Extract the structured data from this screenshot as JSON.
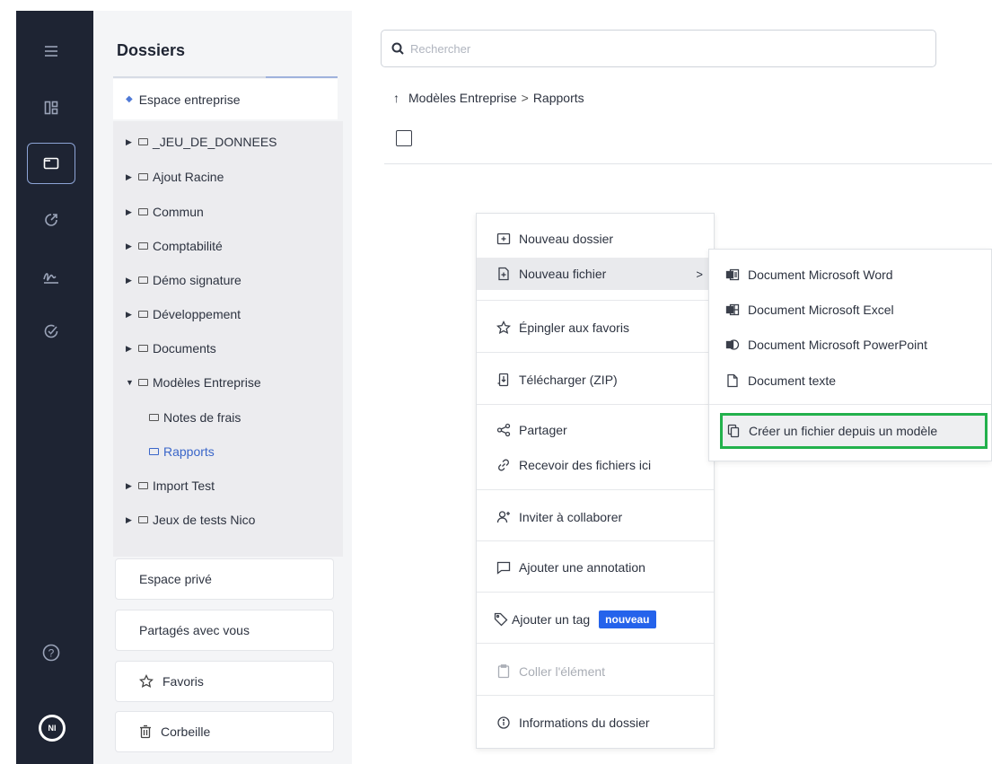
{
  "rail": {
    "icons": [
      "menu-icon",
      "dashboard-icon",
      "folder-icon",
      "activity-icon",
      "signature-icon",
      "check-circle-icon",
      "help-icon"
    ],
    "avatar_initials": "NI",
    "help_glyph": "?"
  },
  "sidebar": {
    "title": "Dossiers",
    "workspace": "Espace entreprise",
    "tree": [
      {
        "label": "_JEU_DE_DONNEES",
        "expanded": false,
        "level": 0
      },
      {
        "label": "Ajout Racine",
        "expanded": false,
        "level": 0
      },
      {
        "label": "Commun",
        "expanded": false,
        "level": 0
      },
      {
        "label": "Comptabilité",
        "expanded": false,
        "level": 0
      },
      {
        "label": "Démo signature",
        "expanded": false,
        "level": 0
      },
      {
        "label": "Développement",
        "expanded": false,
        "level": 0
      },
      {
        "label": "Documents",
        "expanded": false,
        "level": 0
      },
      {
        "label": "Modèles Entreprise",
        "expanded": true,
        "level": 0
      },
      {
        "label": "Notes de frais",
        "level": 1
      },
      {
        "label": "Rapports",
        "level": 1,
        "selected": true
      },
      {
        "label": "Import Test",
        "expanded": false,
        "level": 0
      },
      {
        "label": "Jeux de tests Nico",
        "expanded": false,
        "level": 0
      }
    ],
    "private_space": "Espace privé",
    "shared": "Partagés avec vous",
    "favorites": "Favoris",
    "trash": "Corbeille"
  },
  "search": {
    "placeholder": "Rechercher"
  },
  "breadcrumb": {
    "up": "↑",
    "parent": "Modèles Entreprise",
    "separator": ">",
    "current": "Rapports"
  },
  "context_menu": {
    "new_folder": "Nouveau dossier",
    "new_file": "Nouveau fichier",
    "new_file_chevron": ">",
    "pin": "Épingler aux favoris",
    "download": "Télécharger (ZIP)",
    "share": "Partager",
    "receive": "Recevoir des fichiers ici",
    "invite": "Inviter à collaborer",
    "annotate": "Ajouter une annotation",
    "tag": "Ajouter un tag",
    "tag_badge": "nouveau",
    "paste": "Coller l'élément",
    "info": "Informations du dossier"
  },
  "submenu": {
    "word": "Document Microsoft Word",
    "excel": "Document Microsoft Excel",
    "powerpoint": "Document Microsoft PowerPoint",
    "text": "Document texte",
    "from_template": "Créer un fichier depuis un modèle"
  },
  "colors": {
    "rail_bg": "#1e2433",
    "accent_blue": "#3a66c9",
    "badge_blue": "#2563eb",
    "highlight_green": "#22b14c"
  }
}
